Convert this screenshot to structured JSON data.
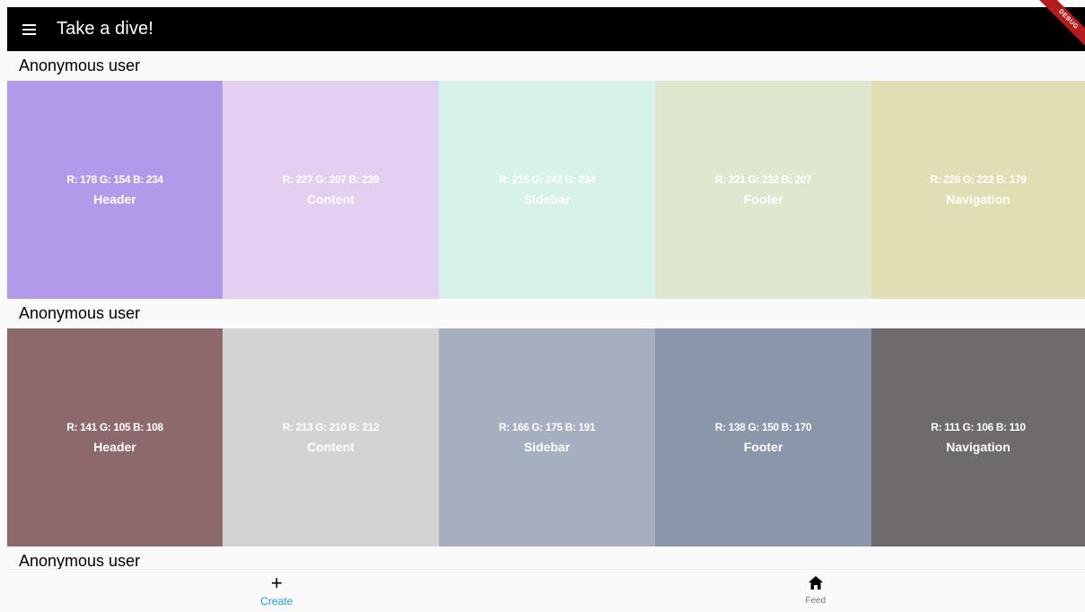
{
  "appbar": {
    "title": "Take a dive!",
    "menu_icon": "menu-icon",
    "debug_banner": "DEBUG"
  },
  "colors": {
    "appbar_bg": "#000000",
    "page_bg": "#fafafa",
    "active_nav": "#2196f3",
    "debug_banner": "#b71c1c"
  },
  "feed": [
    {
      "user": "Anonymous user",
      "swatches": [
        {
          "rgb": "R: 178 G: 154 B: 234",
          "name": "Header",
          "color": "#b29aea"
        },
        {
          "rgb": "R: 227 G: 207 B: 239",
          "name": "Content",
          "color": "#e3cfef"
        },
        {
          "rgb": "R: 215 G: 242 B: 234",
          "name": "Sidebar",
          "color": "#d7f2ea"
        },
        {
          "rgb": "R: 221 G: 232 B: 207",
          "name": "Footer",
          "color": "#dde8cf"
        },
        {
          "rgb": "R: 226 G: 222 B: 179",
          "name": "Navigation",
          "color": "#e2deb3"
        }
      ]
    },
    {
      "user": "Anonymous user",
      "swatches": [
        {
          "rgb": "R: 141 G: 105 B: 108",
          "name": "Header",
          "color": "#8d696c"
        },
        {
          "rgb": "R: 213 G: 210 B: 212",
          "name": "Content",
          "color": "#d5d2d4"
        },
        {
          "rgb": "R: 166 G: 175 B: 191",
          "name": "Sidebar",
          "color": "#a6afbf"
        },
        {
          "rgb": "R: 138 G: 150 B: 170",
          "name": "Footer",
          "color": "#8a96aa"
        },
        {
          "rgb": "R: 111 G: 106 B: 110",
          "name": "Navigation",
          "color": "#6f6a6e"
        }
      ]
    },
    {
      "user": "Anonymous user",
      "swatches": []
    }
  ],
  "bottom_nav": {
    "create": {
      "label": "Create",
      "icon": "plus-icon"
    },
    "feed": {
      "label": "Feed",
      "icon": "home-icon"
    }
  }
}
